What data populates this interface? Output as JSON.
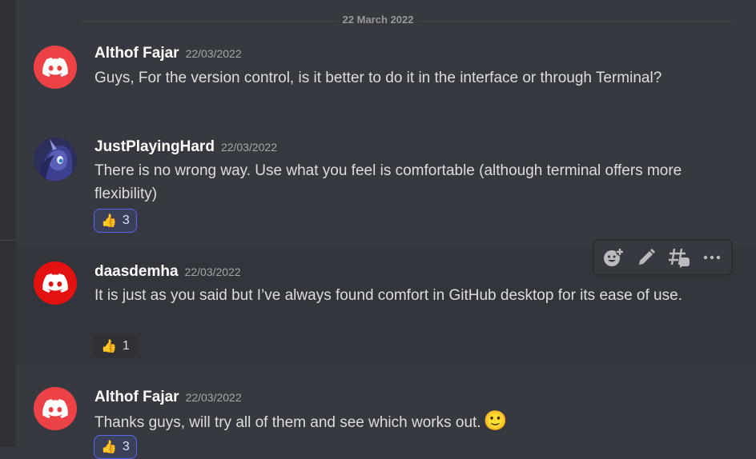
{
  "date_divider": "22 March 2022",
  "messages": [
    {
      "username": "Althof Fajar",
      "timestamp": "22/03/2022",
      "text": "Guys, For the version control, is it better to do it in the interface or through Terminal?",
      "avatar": "discord-logo"
    },
    {
      "username": "JustPlayingHard",
      "timestamp": "22/03/2022",
      "text": "There is no wrong way. Use what you feel is comfortable (although terminal offers more flexibility)",
      "avatar": "pony-avatar",
      "reaction": {
        "emoji": "👍",
        "count": "3",
        "reacted": true
      }
    },
    {
      "username": "daasdemha",
      "timestamp": "22/03/2022",
      "text": "It is just as you said but I’ve always found comfort in GitHub desktop for its ease of use.",
      "avatar": "discord-logo",
      "reaction": {
        "emoji": "👍",
        "count": "1",
        "reacted": false
      }
    },
    {
      "username": "Althof Fajar",
      "timestamp": "22/03/2022",
      "text": "Thanks guys, will try all of them and see which works out.",
      "emoji": "🙂",
      "avatar": "discord-logo",
      "reaction": {
        "emoji": "👍",
        "count": "3",
        "reacted": true
      }
    }
  ],
  "toolbar": {
    "icons": [
      "add-reaction-icon",
      "edit-icon",
      "create-thread-icon",
      "more-icon"
    ]
  },
  "colors": {
    "background": "#36393f",
    "username": "#ffffff",
    "timestamp": "#a3a6aa",
    "avatar_red": "#ed4245",
    "reaction_active_border": "#5865f2"
  }
}
